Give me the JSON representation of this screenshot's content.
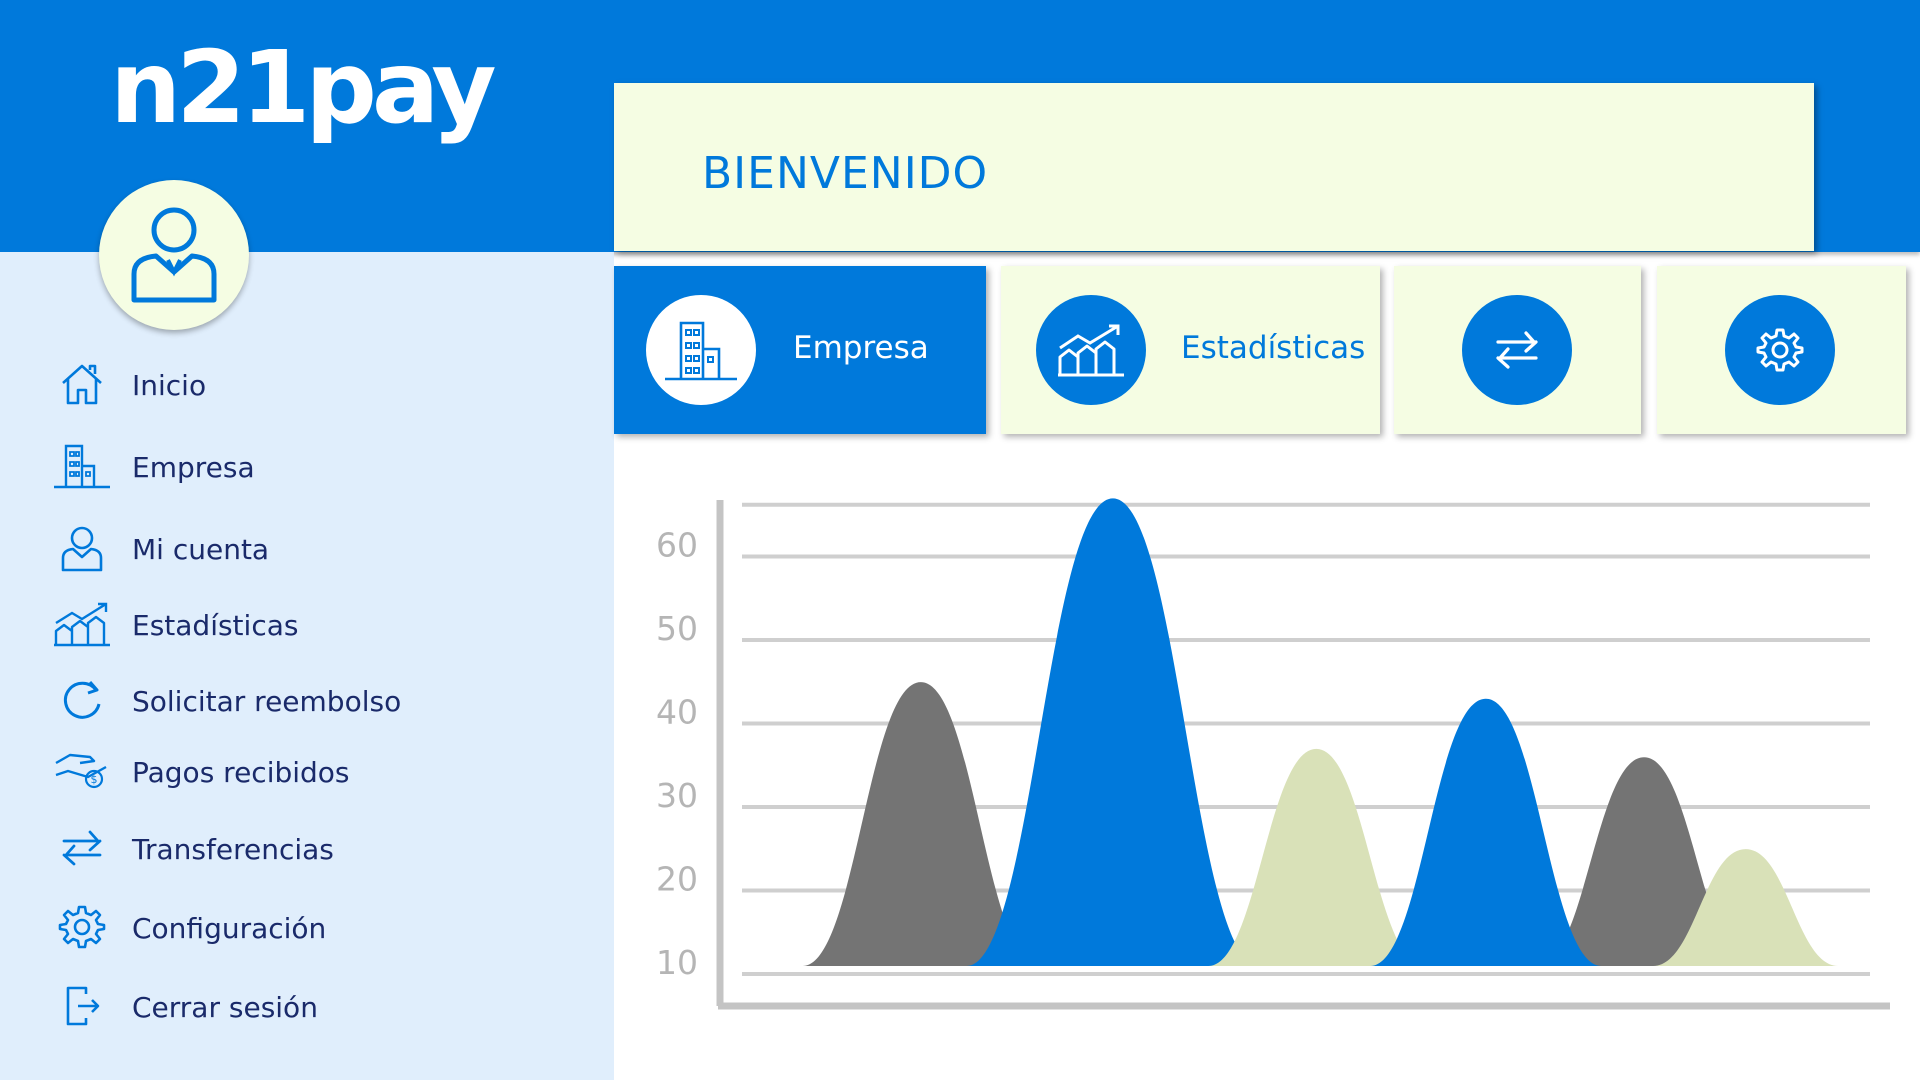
{
  "brand": {
    "logo_text": "n21pay",
    "primary_color": "#0079db",
    "panel_color": "#f5fde3",
    "sidebar_color": "#e0eefc"
  },
  "header": {
    "welcome": "BIENVENIDO"
  },
  "sidebar": {
    "avatar_icon": "user-avatar-icon",
    "items": [
      {
        "label": "Inicio",
        "icon": "home-icon"
      },
      {
        "label": "Empresa",
        "icon": "building-icon"
      },
      {
        "label": "Mi cuenta",
        "icon": "user-icon"
      },
      {
        "label": "Estadísticas",
        "icon": "chart-icon"
      },
      {
        "label": "Solicitar reembolso",
        "icon": "refresh-icon"
      },
      {
        "label": "Pagos recibidos",
        "icon": "payment-hand-icon"
      },
      {
        "label": "Transferencias",
        "icon": "transfer-icon"
      },
      {
        "label": "Configuración",
        "icon": "gear-icon"
      },
      {
        "label": "Cerrar sesión",
        "icon": "logout-icon"
      }
    ]
  },
  "cards": [
    {
      "label": "Empresa",
      "icon": "building-icon",
      "active": true
    },
    {
      "label": "Estadísticas",
      "icon": "chart-icon",
      "active": false
    },
    {
      "label": "",
      "icon": "transfer-icon",
      "active": false
    },
    {
      "label": "",
      "icon": "gear-icon",
      "active": false
    }
  ],
  "chart_data": {
    "type": "area",
    "title": "",
    "xlabel": "",
    "ylabel": "",
    "yticks": [
      10,
      20,
      30,
      40,
      50,
      60
    ],
    "ylim": [
      10,
      65
    ],
    "grid": true,
    "series": [
      {
        "color": "#747474",
        "peaks": [
          {
            "x": 1.6,
            "y": 44
          },
          {
            "x": 8.0,
            "y": 35
          }
        ]
      },
      {
        "color": "#0079db",
        "peaks": [
          {
            "x": 3.3,
            "y": 66
          },
          {
            "x": 6.6,
            "y": 42
          }
        ]
      },
      {
        "color": "#d9e1b8",
        "peaks": [
          {
            "x": 5.1,
            "y": 36
          },
          {
            "x": 8.9,
            "y": 24
          }
        ]
      }
    ]
  }
}
